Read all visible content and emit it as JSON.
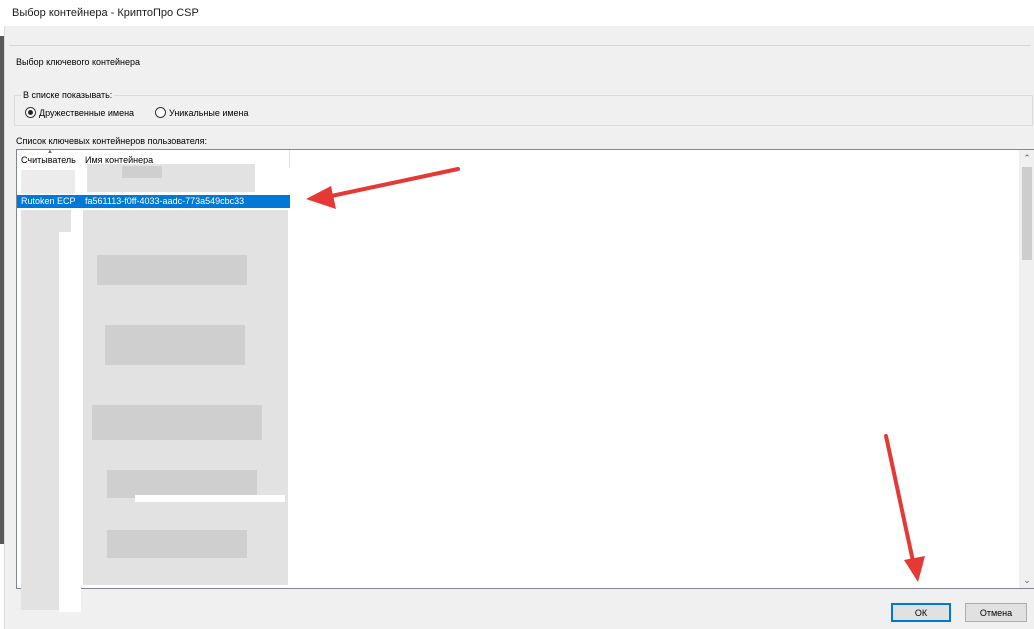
{
  "window": {
    "title": "Выбор контейнера - КриптоПро CSP"
  },
  "header": {
    "title": "Выбор ключевого контейнера"
  },
  "display_group": {
    "legend": "В списке показывать:",
    "options": [
      {
        "label": "Дружественные имена",
        "checked": true
      },
      {
        "label": "Уникальные имена",
        "checked": false
      }
    ]
  },
  "list": {
    "label": "Список ключевых контейнеров пользователя:",
    "columns": [
      "Считыватель",
      "Имя контейнера"
    ],
    "selected_row": {
      "reader": "Rutoken ECP",
      "container": "fa561113-f0ff-4033-aadc-773a549cbc33"
    },
    "selection_color": "#0078d7"
  },
  "buttons": {
    "ok": "ОК",
    "cancel": "Отмена"
  },
  "annotations": {
    "arrow_color": "#e53935"
  }
}
